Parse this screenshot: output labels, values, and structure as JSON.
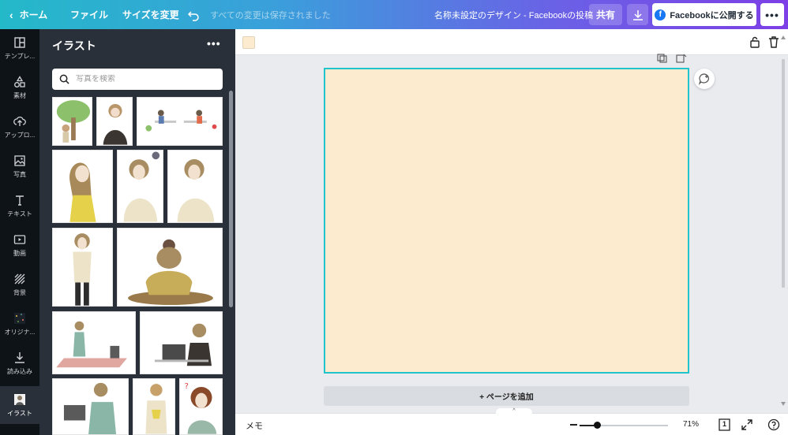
{
  "topbar": {
    "home": "ホーム",
    "file": "ファイル",
    "resize": "サイズを変更",
    "saved": "すべての変更は保存されました",
    "design_title": "名称未設定のデザイン - Facebookの投稿",
    "share": "共有",
    "publish": "Facebookに公開する"
  },
  "rail": {
    "items": [
      {
        "label": "テンプレ...",
        "icon": "template-icon"
      },
      {
        "label": "素材",
        "icon": "elements-icon"
      },
      {
        "label": "アップロ...",
        "icon": "upload-icon"
      },
      {
        "label": "写真",
        "icon": "photo-icon"
      },
      {
        "label": "テキスト",
        "icon": "text-icon"
      },
      {
        "label": "動画",
        "icon": "video-icon"
      },
      {
        "label": "背景",
        "icon": "background-icon"
      },
      {
        "label": "オリジナ...",
        "icon": "original-icon"
      },
      {
        "label": "読み込み",
        "icon": "import-icon"
      },
      {
        "label": "イラスト",
        "icon": "illustration-icon"
      }
    ]
  },
  "panel": {
    "title": "イラスト",
    "search_placeholder": "写真を検索"
  },
  "editor": {
    "background_color": "#fdebd0",
    "accent": "#20c4cb",
    "add_page": "+ ページを追加"
  },
  "bottombar": {
    "memo": "メモ",
    "zoom": "71%",
    "page_count": "1",
    "zoom_fraction": 0.2
  }
}
